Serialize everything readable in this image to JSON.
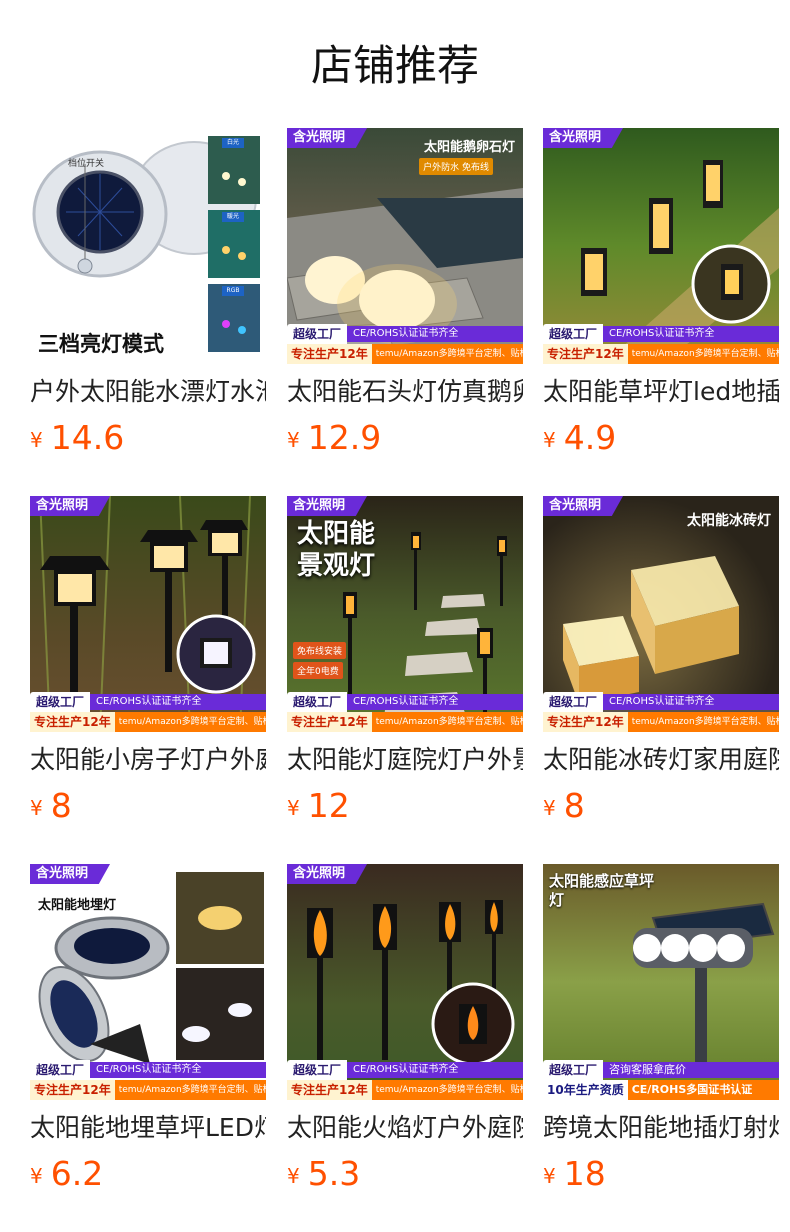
{
  "page": {
    "title": "店铺推荐"
  },
  "products": [
    {
      "name": "户外太阳能水漂灯水池灯",
      "currency": "¥",
      "price": "14.6",
      "image": {
        "mode_label": "三档亮灯模式",
        "switch_label": "档位开关",
        "chips": [
          "白光",
          "暖光",
          "RGB"
        ]
      }
    },
    {
      "name": "太阳能石头灯仿真鹅卵石灯",
      "currency": "¥",
      "price": "12.9",
      "image": {
        "brand": "含光照明",
        "heading": "太阳能鹅卵石灯",
        "sub": "户外防水 免布线",
        "factory": "超级工厂",
        "cert": "CE/ROHS认证证书齐全",
        "years": "专注生产12年",
        "platform": "temu/Amazon多跨境平台定制、贴标"
      }
    },
    {
      "name": "太阳能草坪灯led地插灯",
      "currency": "¥",
      "price": "4.9",
      "image": {
        "brand": "含光照明",
        "factory": "超级工厂",
        "cert": "CE/ROHS认证证书齐全",
        "years": "专注生产12年",
        "platform": "temu/Amazon多跨境平台定制、贴标"
      }
    },
    {
      "name": "太阳能小房子灯户外庭院灯",
      "currency": "¥",
      "price": "8",
      "image": {
        "brand": "含光照明",
        "factory": "超级工厂",
        "cert": "CE/ROHS认证证书齐全",
        "years": "专注生产12年",
        "platform": "temu/Amazon多跨境平台定制、贴标"
      }
    },
    {
      "name": "太阳能灯庭院灯户外景观灯",
      "currency": "¥",
      "price": "12",
      "image": {
        "brand": "含光照明",
        "heading": "太阳能景观灯",
        "badge1": "免布线安装",
        "badge2": "全年0电费",
        "factory": "超级工厂",
        "cert": "CE/ROHS认证证书齐全",
        "years": "专注生产12年",
        "platform": "temu/Amazon多跨境平台定制、贴标"
      }
    },
    {
      "name": "太阳能冰砖灯家用庭院灯",
      "currency": "¥",
      "price": "8",
      "image": {
        "brand": "含光照明",
        "heading": "太阳能冰砖灯",
        "factory": "超级工厂",
        "cert": "CE/ROHS认证证书齐全",
        "years": "专注生产12年",
        "platform": "temu/Amazon多跨境平台定制、贴标"
      }
    },
    {
      "name": "太阳能地埋草坪LED灯",
      "currency": "¥",
      "price": "6.2",
      "image": {
        "brand": "含光照明",
        "heading": "太阳能地埋灯",
        "factory": "超级工厂",
        "cert": "CE/ROHS认证证书齐全",
        "years": "专注生产12年",
        "platform": "temu/Amazon多跨境平台定制、贴标"
      }
    },
    {
      "name": "太阳能火焰灯户外庭院灯",
      "currency": "¥",
      "price": "5.3",
      "image": {
        "brand": "含光照明",
        "factory": "超级工厂",
        "cert": "CE/ROHS认证证书齐全",
        "years": "专注生产12年",
        "platform": "temu/Amazon多跨境平台定制、贴标"
      }
    },
    {
      "name": "跨境太阳能地插灯射灯",
      "currency": "¥",
      "price": "18",
      "image": {
        "heading": "太阳能感应草坪灯",
        "factory": "超级工厂",
        "service": "咨询客服拿底价",
        "years": "10年生产资质",
        "cert": "CE/ROHS多国证书认证"
      }
    }
  ]
}
